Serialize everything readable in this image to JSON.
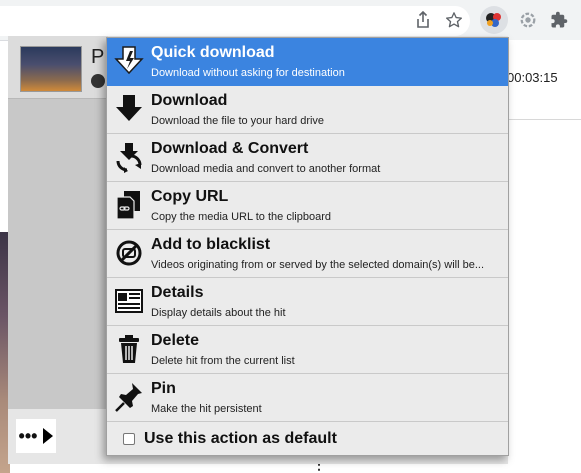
{
  "background": {
    "popup_title_initial": "P",
    "time_text": "00:03:15"
  },
  "menu": {
    "items": [
      {
        "id": "quick-download",
        "title": "Quick download",
        "description": "Download without asking for destination",
        "icon": "quick-download-icon",
        "active": true
      },
      {
        "id": "download",
        "title": "Download",
        "description": "Download the file to your hard drive",
        "icon": "download-arrow-icon",
        "active": false
      },
      {
        "id": "download-convert",
        "title": "Download & Convert",
        "description": "Download media and convert to another format",
        "icon": "download-convert-icon",
        "active": false
      },
      {
        "id": "copy-url",
        "title": "Copy URL",
        "description": "Copy the media URL to the clipboard",
        "icon": "copy-url-icon",
        "active": false
      },
      {
        "id": "add-blacklist",
        "title": "Add to blacklist",
        "description": "Videos originating from or served by the selected domain(s) will be...",
        "icon": "blacklist-icon",
        "active": false
      },
      {
        "id": "details",
        "title": "Details",
        "description": "Display details about the hit",
        "icon": "details-icon",
        "active": false
      },
      {
        "id": "delete",
        "title": "Delete",
        "description": "Delete hit from the current list",
        "icon": "trash-icon",
        "active": false
      },
      {
        "id": "pin",
        "title": "Pin",
        "description": "Make the hit persistent",
        "icon": "pin-icon",
        "active": false
      }
    ],
    "footer_label": "Use this action as default",
    "footer_checked": false
  },
  "colors": {
    "active_highlight": "#3b84e0",
    "menu_background": "#ebebeb"
  }
}
